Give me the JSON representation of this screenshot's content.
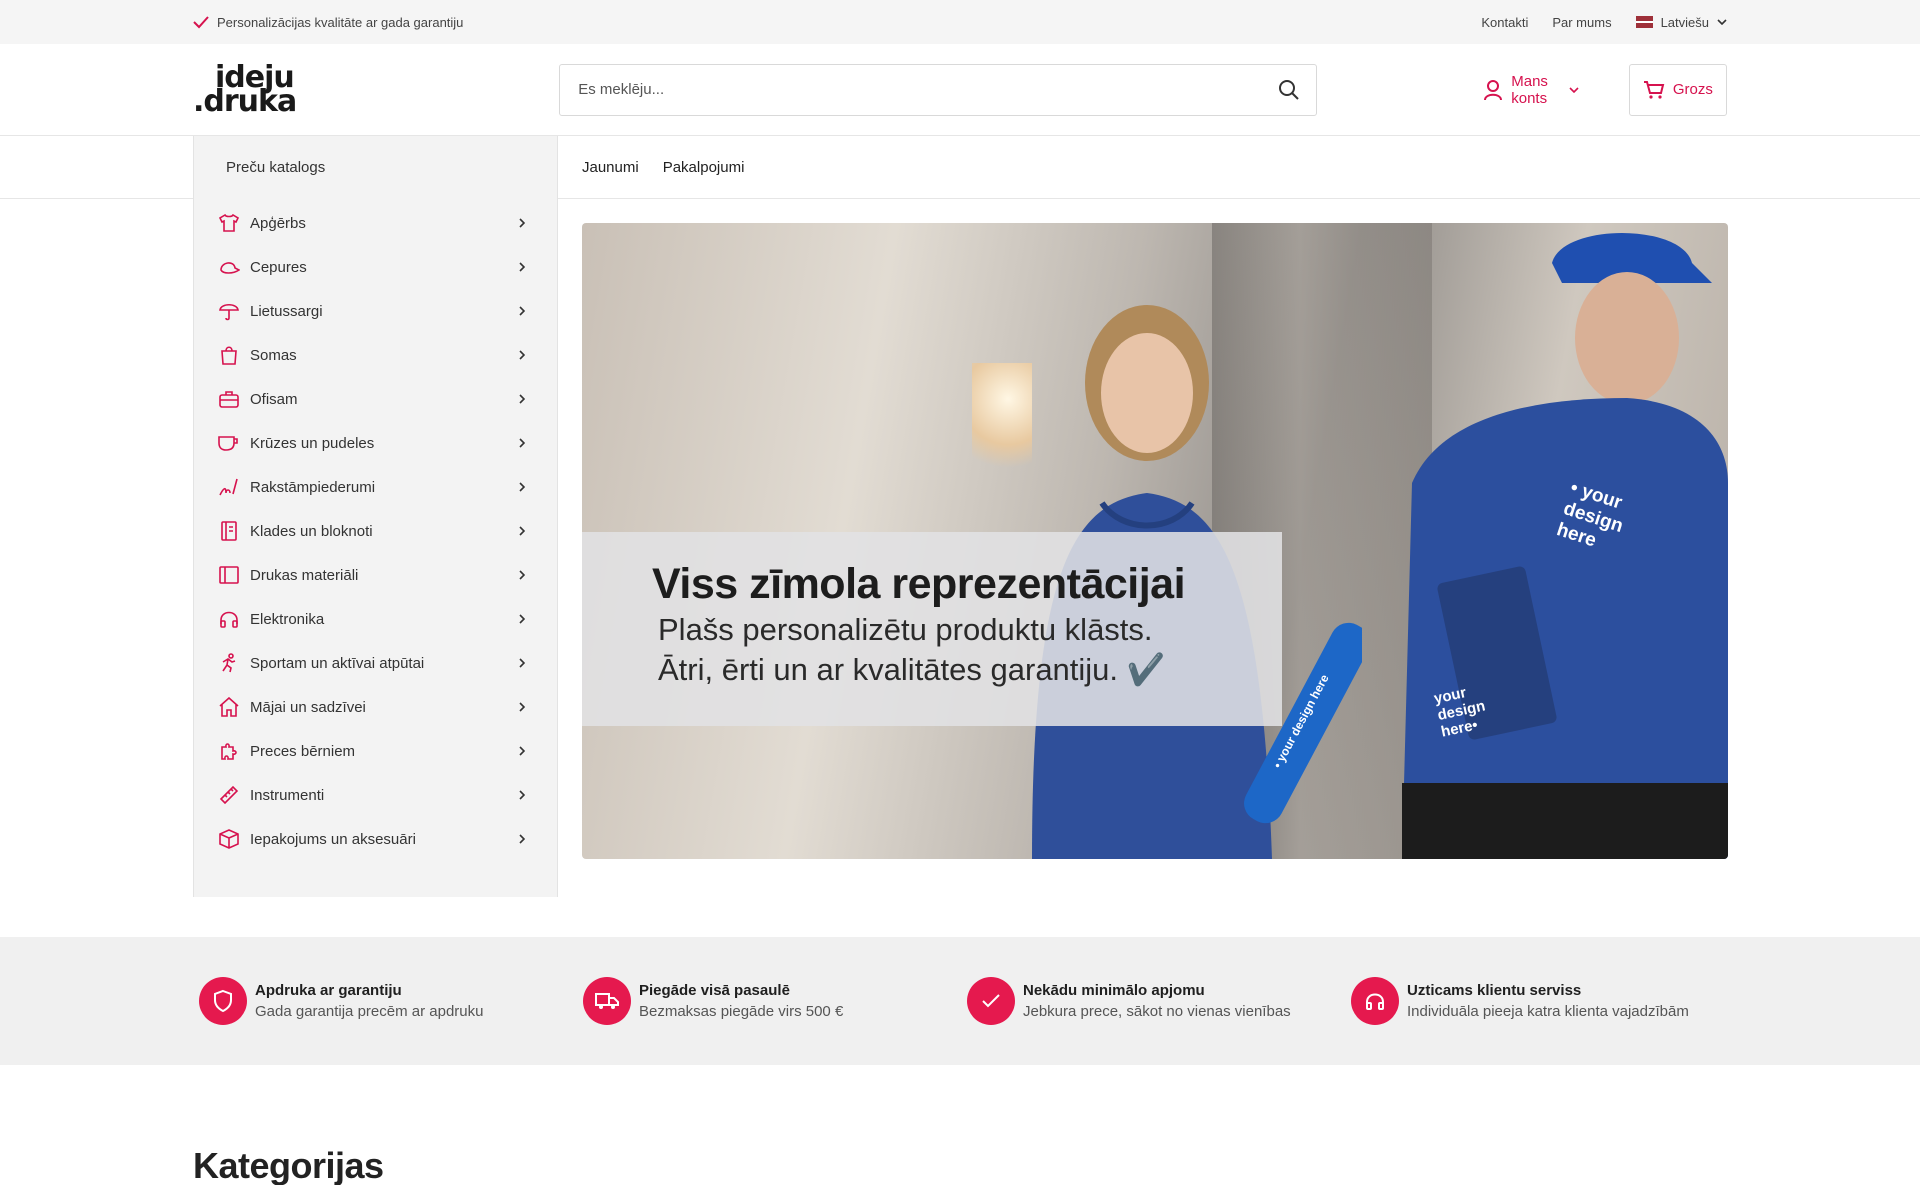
{
  "topbar": {
    "guarantee": "Personalizācijas kvalitāte ar gada garantiju",
    "links": [
      "Kontakti",
      "Par mums"
    ],
    "language": "Latviešu"
  },
  "header": {
    "logo_line1": "ideju",
    "logo_line2": ".druka",
    "search_placeholder": "Es meklēju...",
    "account": "Mans konts",
    "cart": "Grozs"
  },
  "nav": {
    "catalog": "Preču katalogs",
    "links": [
      "Jaunumi",
      "Pakalpojumi"
    ]
  },
  "categories": [
    {
      "label": "Apģērbs",
      "icon": "shirt-icon"
    },
    {
      "label": "Cepures",
      "icon": "cap-icon"
    },
    {
      "label": "Lietussargi",
      "icon": "umbrella-icon"
    },
    {
      "label": "Somas",
      "icon": "bag-icon"
    },
    {
      "label": "Ofisam",
      "icon": "briefcase-icon"
    },
    {
      "label": "Krūzes un pudeles",
      "icon": "mug-icon"
    },
    {
      "label": "Rakstāmpiederumi",
      "icon": "pen-icon"
    },
    {
      "label": "Klades un bloknoti",
      "icon": "notebook-icon"
    },
    {
      "label": "Drukas materiāli",
      "icon": "print-icon"
    },
    {
      "label": "Elektronika",
      "icon": "headphones-icon"
    },
    {
      "label": "Sportam un aktīvai atpūtai",
      "icon": "running-icon"
    },
    {
      "label": "Mājai un sadzīvei",
      "icon": "home-icon"
    },
    {
      "label": "Preces bērniem",
      "icon": "puzzle-icon"
    },
    {
      "label": "Instrumenti",
      "icon": "ruler-icon"
    },
    {
      "label": "Iepakojums un aksesuāri",
      "icon": "box-icon"
    }
  ],
  "hero": {
    "headline": "Viss zīmola reprezentācijai",
    "line1": "Plašs personalizētu produktu klāsts.",
    "line2": "Ātri, ērti un ar kvalitātes garantiju. ✔️",
    "tag_shirt": "• your design here",
    "tag_notebook": "your design here•",
    "tag_bottle": "• your design here"
  },
  "features": [
    {
      "title": "Apdruka ar garantiju",
      "subtitle": "Gada garantija precēm ar apdruku",
      "icon": "shield-icon"
    },
    {
      "title": "Piegāde visā pasaulē",
      "subtitle": "Bezmaksas piegāde virs 500 €",
      "icon": "truck-icon"
    },
    {
      "title": "Nekādu minimālo apjomu",
      "subtitle": "Jebkura prece, sākot no vienas vienības",
      "icon": "check-icon"
    },
    {
      "title": "Uzticams klientu serviss",
      "subtitle": "Individuāla pieeja katra klienta vajadzībām",
      "icon": "headset-icon"
    }
  ],
  "section_title": "Kategorijas",
  "colors": {
    "accent": "#e5194e",
    "accent_text": "#d6124e"
  }
}
